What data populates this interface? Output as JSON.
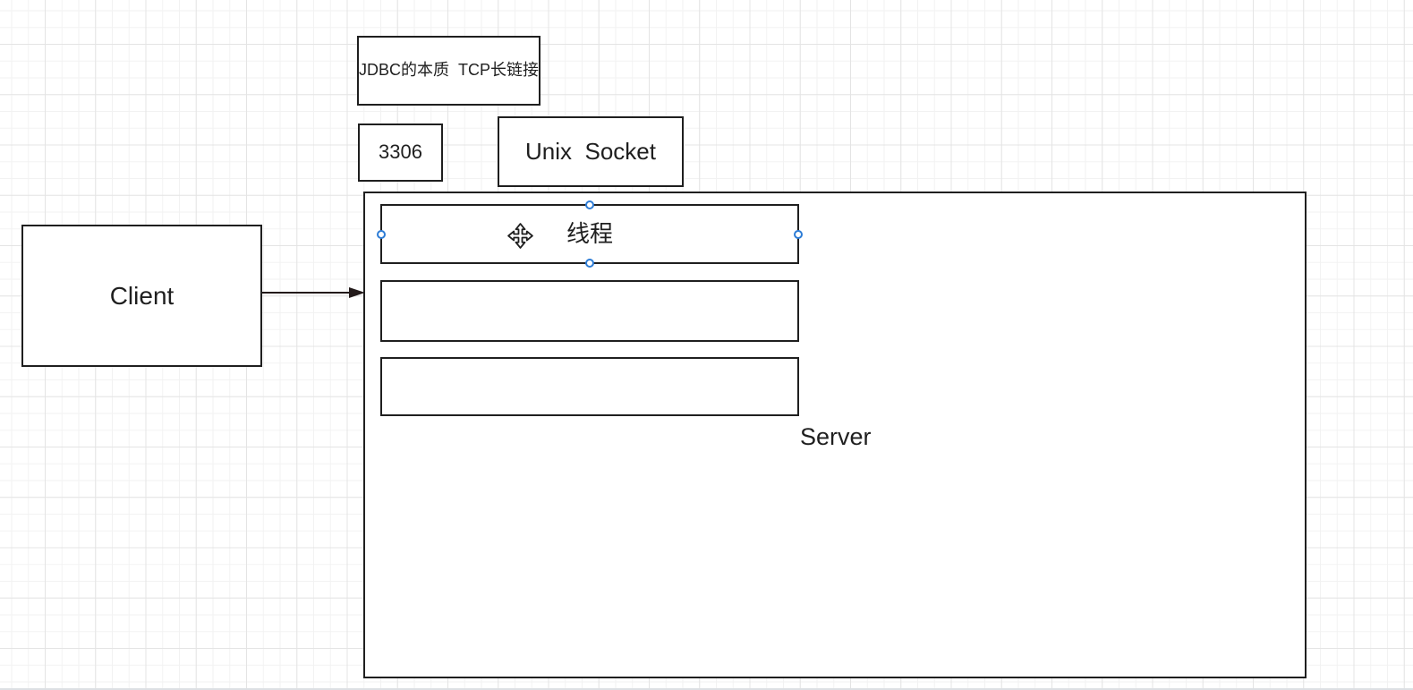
{
  "colors": {
    "canvas_bg": "#ffffff",
    "grid_minor": "#f2f2f2",
    "grid_major": "#e4e4e4",
    "shape_border": "#1f1f1f",
    "shape_fill": "#ffffff",
    "text": "#1f1f1f",
    "arrow": "#231a1a",
    "selection_handle": "#2d7cd6"
  },
  "diagram": {
    "jdbc_note": {
      "label": "JDBC的本质  TCP长链接"
    },
    "port_box": {
      "label": "3306"
    },
    "unix_socket_box": {
      "label": "Unix  Socket"
    },
    "client_box": {
      "label": "Client"
    },
    "connector": {
      "type": "arrow",
      "from": "Client",
      "to": "Server"
    },
    "server": {
      "label": "Server",
      "thread_box": {
        "label": "线程",
        "selected": true
      },
      "empty_box_2": {
        "label": ""
      },
      "empty_box_3": {
        "label": ""
      }
    },
    "cursor": {
      "icon": "move-cursor"
    }
  }
}
